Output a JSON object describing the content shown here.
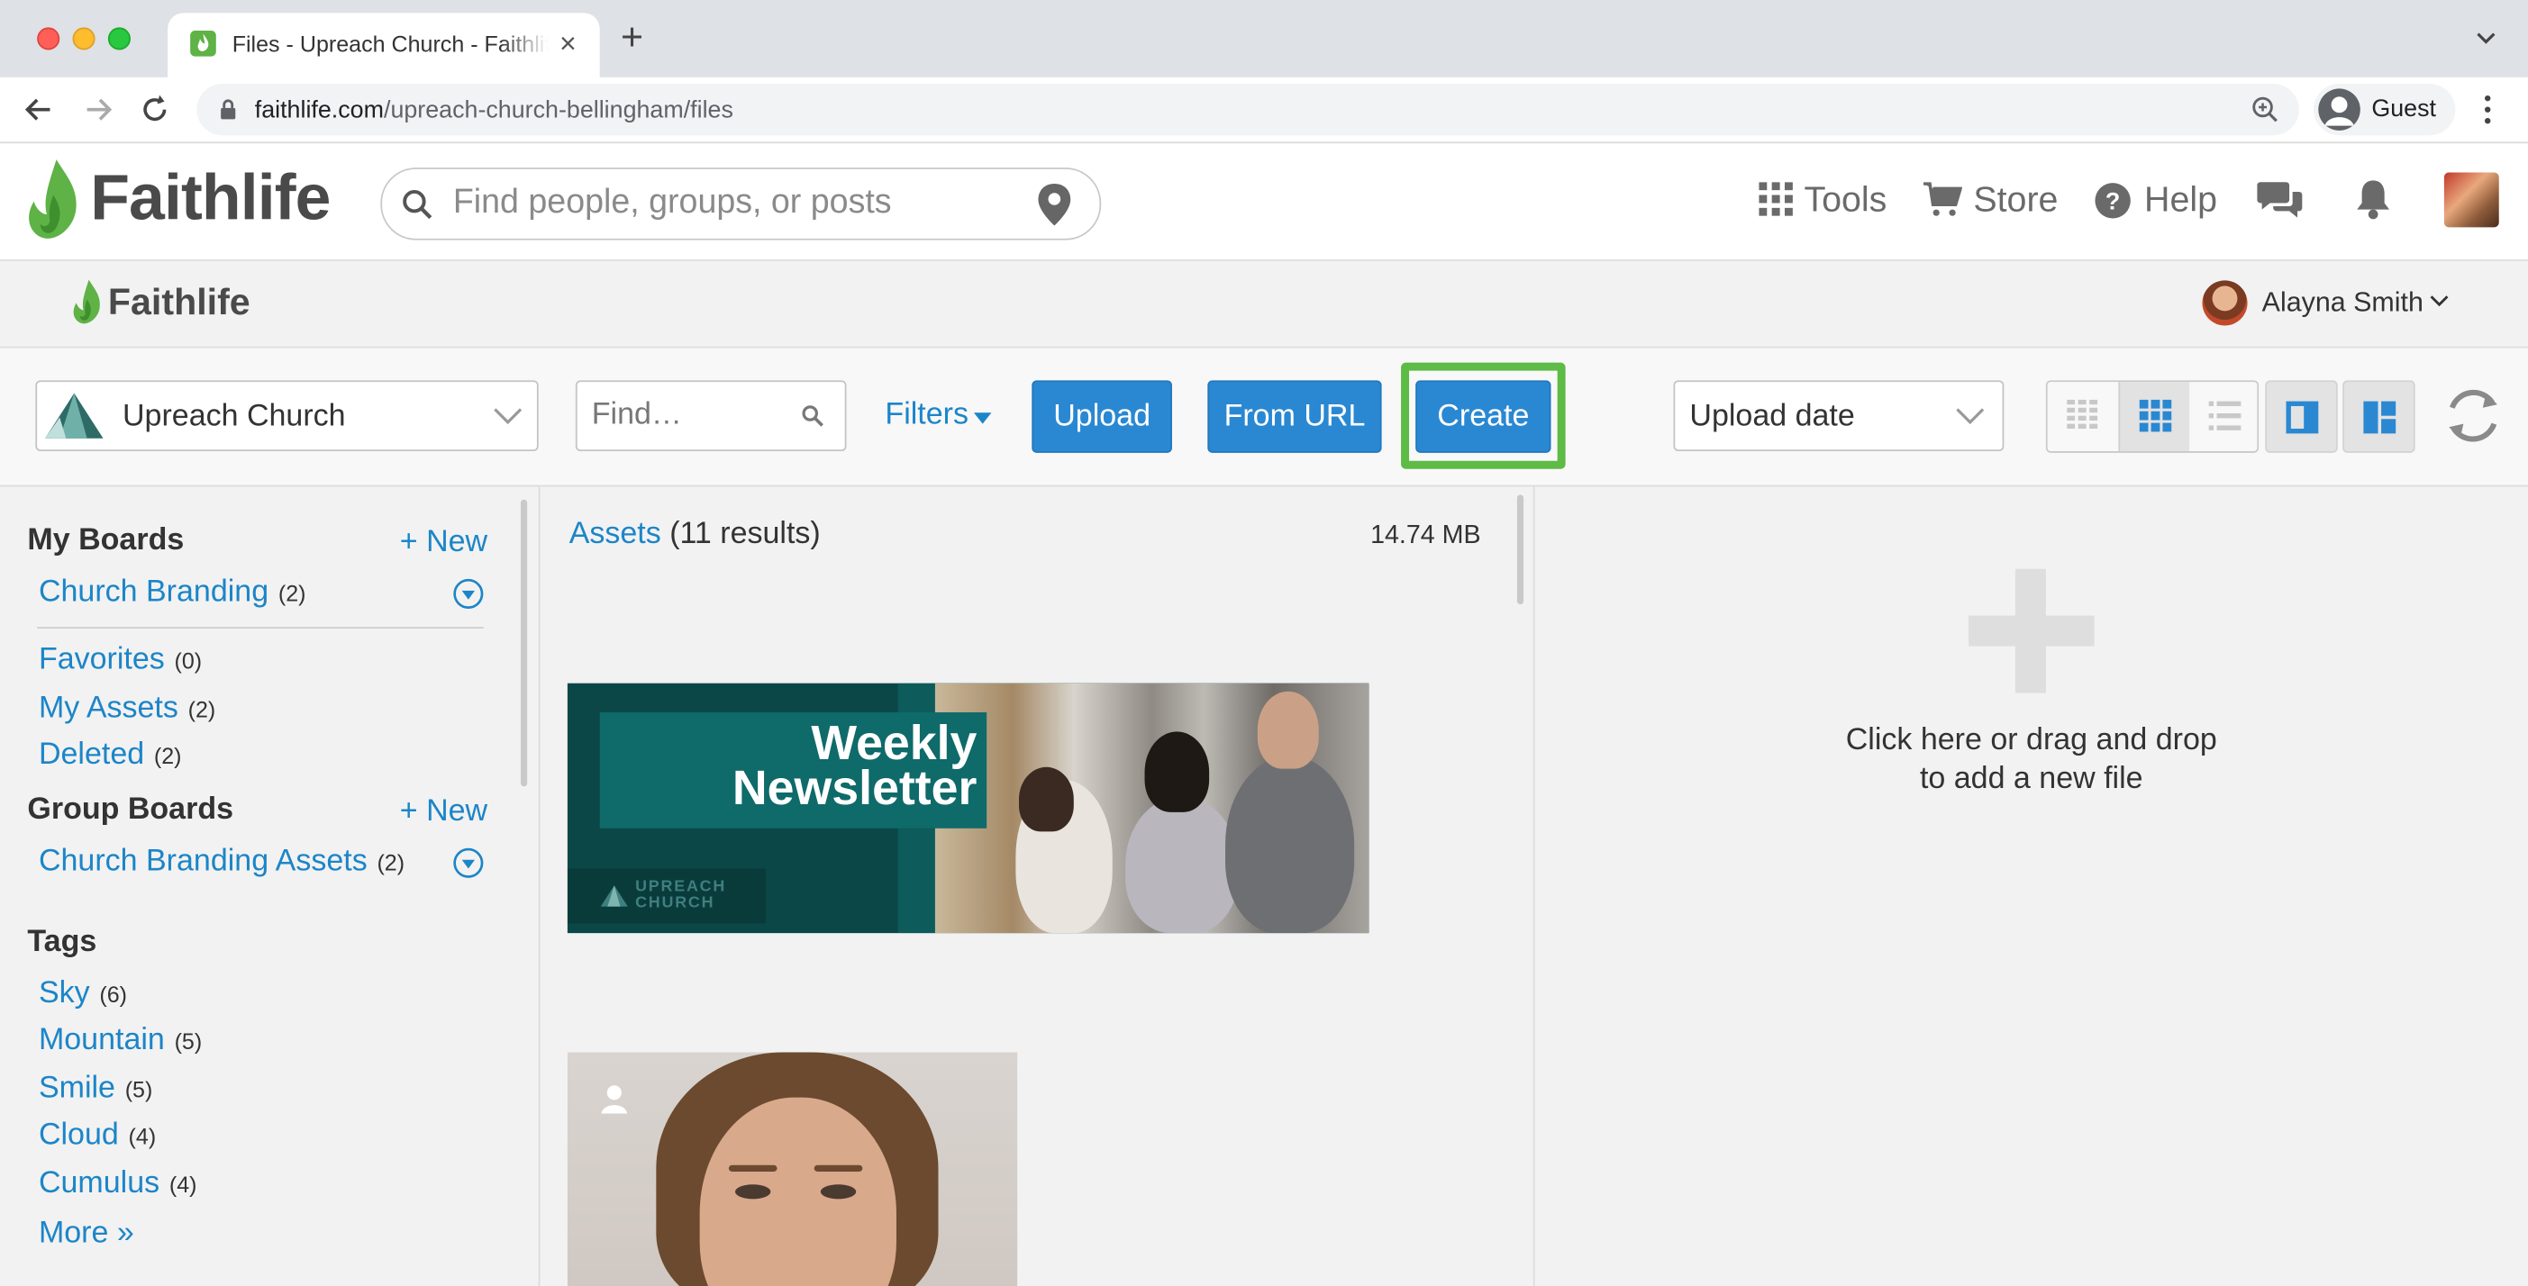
{
  "browser": {
    "tab_title": "Files - Upreach Church - Faithlife",
    "new_tab": "+",
    "close_tab": "×",
    "url_host": "faithlife.com",
    "url_path": "/upreach-church-bellingham/files",
    "profile_label": "Guest"
  },
  "header": {
    "logo_text": "Faithlife",
    "search_placeholder": "Find people, groups, or posts",
    "tools_label": "Tools",
    "store_label": "Store",
    "help_label": "Help"
  },
  "subheader": {
    "logo_text": "Faithlife",
    "user_name": "Alayna Smith"
  },
  "actionbar": {
    "group_selected": "Upreach Church",
    "find_placeholder": "Find…",
    "filters_label": "Filters",
    "upload_label": "Upload",
    "from_url_label": "From URL",
    "create_label": "Create",
    "sort_selected": "Upload date"
  },
  "sidebar": {
    "my_boards_heading": "My Boards",
    "group_boards_heading": "Group Boards",
    "tags_heading": "Tags",
    "new_label": "+ New",
    "my_boards": [
      {
        "label": "Church Branding",
        "count": "(2)"
      }
    ],
    "system_boards": [
      {
        "label": "Favorites",
        "count": "(0)"
      },
      {
        "label": "My Assets",
        "count": "(2)"
      },
      {
        "label": "Deleted",
        "count": "(2)"
      }
    ],
    "group_boards": [
      {
        "label": "Church Branding Assets",
        "count": "(2)"
      }
    ],
    "tags": [
      {
        "label": "Sky",
        "count": "(6)"
      },
      {
        "label": "Mountain",
        "count": "(5)"
      },
      {
        "label": "Smile",
        "count": "(5)"
      },
      {
        "label": "Cloud",
        "count": "(4)"
      },
      {
        "label": "Cumulus",
        "count": "(4)"
      }
    ],
    "more_label": "More »"
  },
  "content": {
    "assets_label": "Assets",
    "results_label": "(11 results)",
    "total_size": "14.74 MB",
    "thumb1_text": "Weekly Newsletter",
    "thumb1_brand_top": "UPREACH",
    "thumb1_brand_bottom": "CHURCH"
  },
  "drop_panel": {
    "line1": "Click here or drag and drop",
    "line2": "to add a new file"
  },
  "colors": {
    "link_blue": "#1c85c8",
    "button_blue": "#2a88d2",
    "highlight_green": "#5dbb46",
    "brand_green": "#5fb246"
  }
}
